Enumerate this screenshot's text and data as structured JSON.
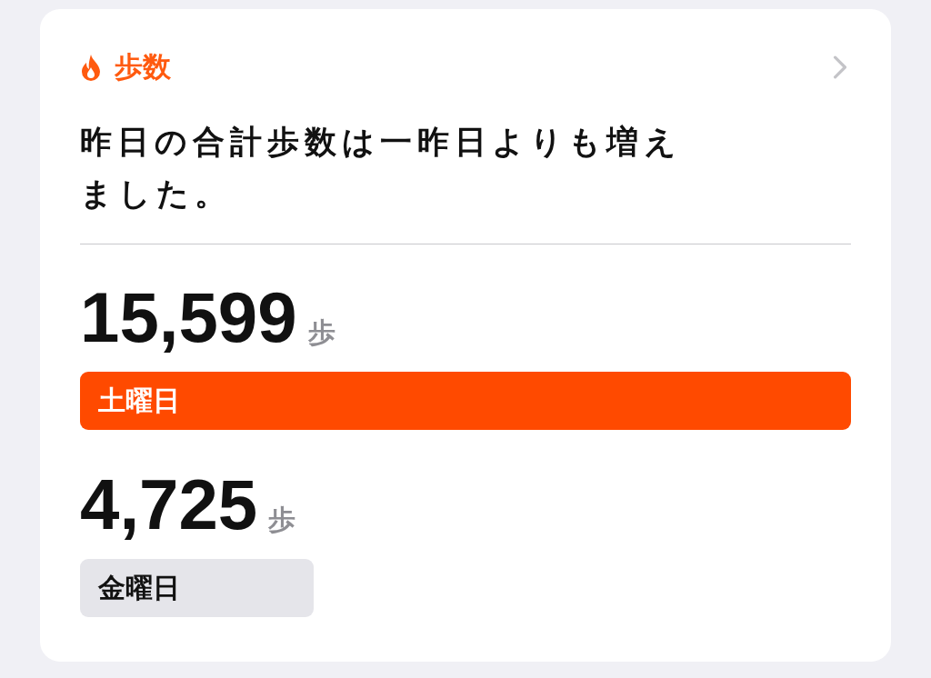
{
  "header": {
    "title": "歩数"
  },
  "summary": "昨日の合計歩数は一昨日よりも増えました。",
  "entries": [
    {
      "value": "15,599",
      "unit": "歩",
      "day": "土曜日",
      "highlighted": true
    },
    {
      "value": "4,725",
      "unit": "歩",
      "day": "金曜日",
      "highlighted": false
    }
  ]
}
